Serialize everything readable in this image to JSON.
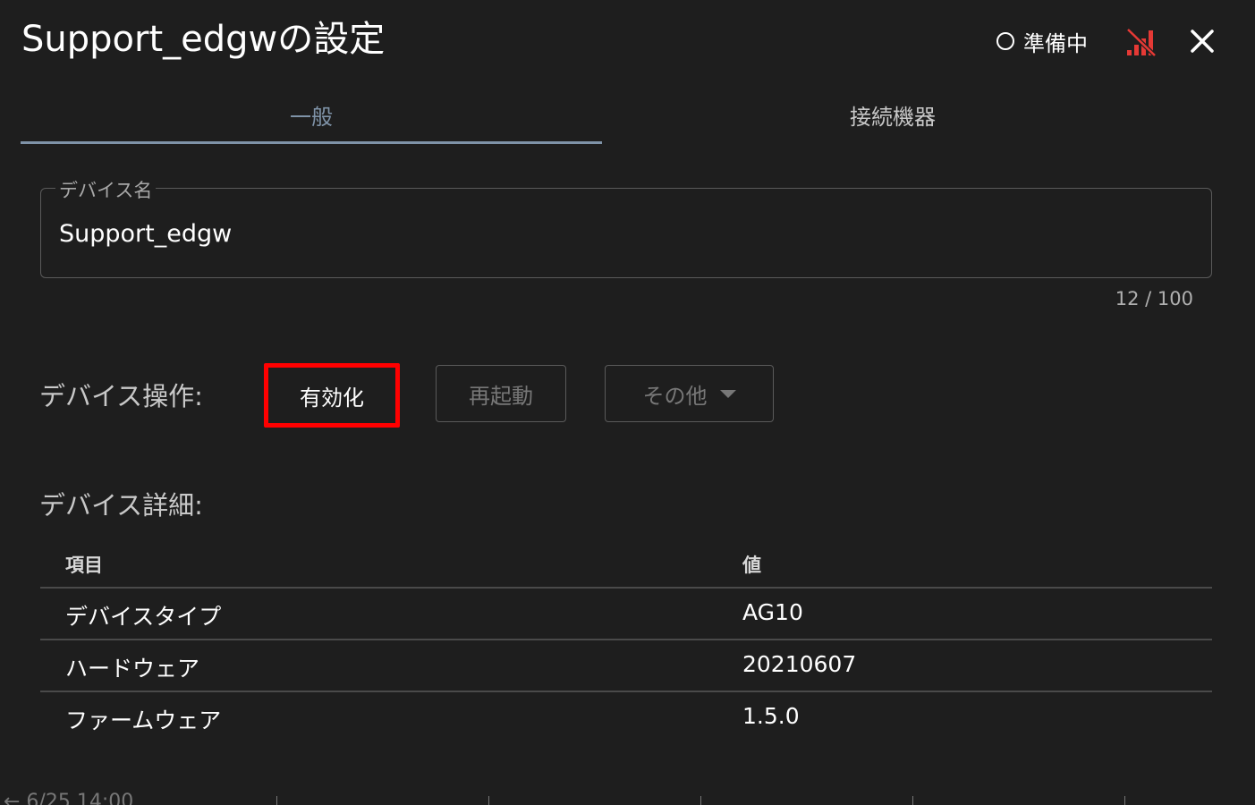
{
  "header": {
    "title": "Support_edgwの設定",
    "status_text": "準備中",
    "status_icon": "circle-outline-icon",
    "signal_icon": "signal-off-icon",
    "signal_color": "#e53935",
    "close_icon": "close-icon"
  },
  "tabs": [
    {
      "label": "一般",
      "active": true
    },
    {
      "label": "接続機器",
      "active": false
    }
  ],
  "device_name_field": {
    "label": "デバイス名",
    "value": "Support_edgw",
    "counter": "12 / 100"
  },
  "operations": {
    "label": "デバイス操作:",
    "enable_label": "有効化",
    "restart_label": "再起動",
    "other_label": "その他",
    "highlight_color": "#ff0000"
  },
  "details": {
    "label": "デバイス詳細:",
    "columns": [
      "項目",
      "値"
    ],
    "rows": [
      [
        "デバイスタイプ",
        "AG10"
      ],
      [
        "ハードウェア",
        "20210607"
      ],
      [
        "ファームウェア",
        "1.5.0"
      ]
    ]
  },
  "background_strip": {
    "text": "← 6/25 14:00"
  }
}
